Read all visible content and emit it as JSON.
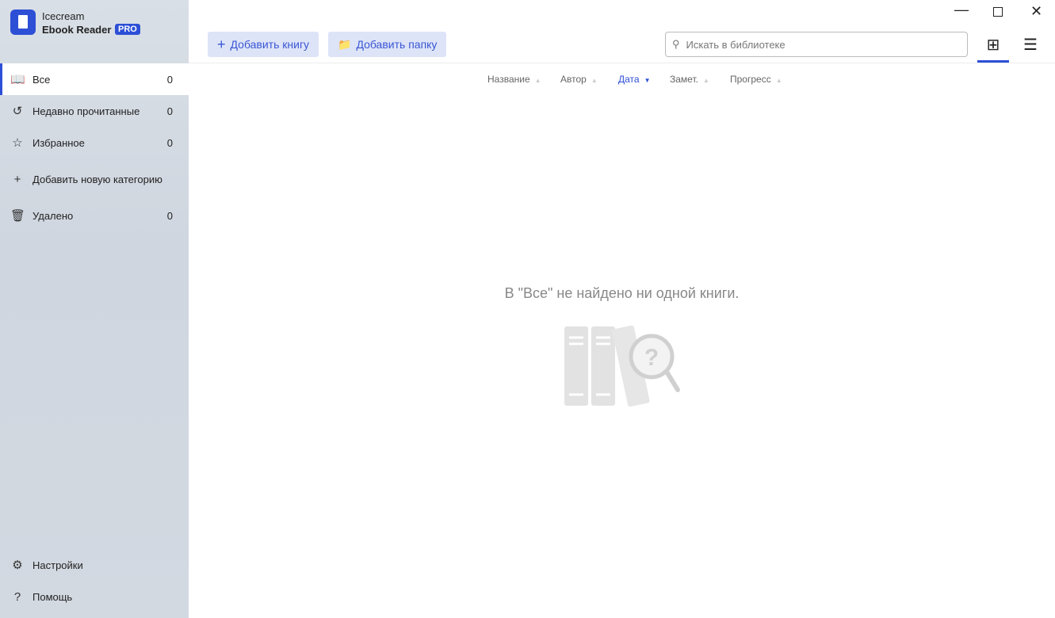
{
  "app": {
    "name_line1": "Icecream",
    "name_line2": "Ebook Reader",
    "badge": "PRO"
  },
  "sidebar": {
    "items": [
      {
        "label": "Все",
        "count": "0"
      },
      {
        "label": "Недавно прочитанные",
        "count": "0"
      },
      {
        "label": "Избранное",
        "count": "0"
      },
      {
        "label": "Добавить новую категорию"
      },
      {
        "label": "Удалено",
        "count": "0"
      }
    ],
    "settings": "Настройки",
    "help": "Помощь"
  },
  "toolbar": {
    "add_book": "Добавить книгу",
    "add_folder": "Добавить папку",
    "search_placeholder": "Искать в библиотеке"
  },
  "sort": [
    "Название",
    "Автор",
    "Дата",
    "Замет.",
    "Прогресс"
  ],
  "empty_message": "В \"Все\" не найдено ни одной книги.",
  "colors": {
    "accent": "#2d4fd6"
  }
}
